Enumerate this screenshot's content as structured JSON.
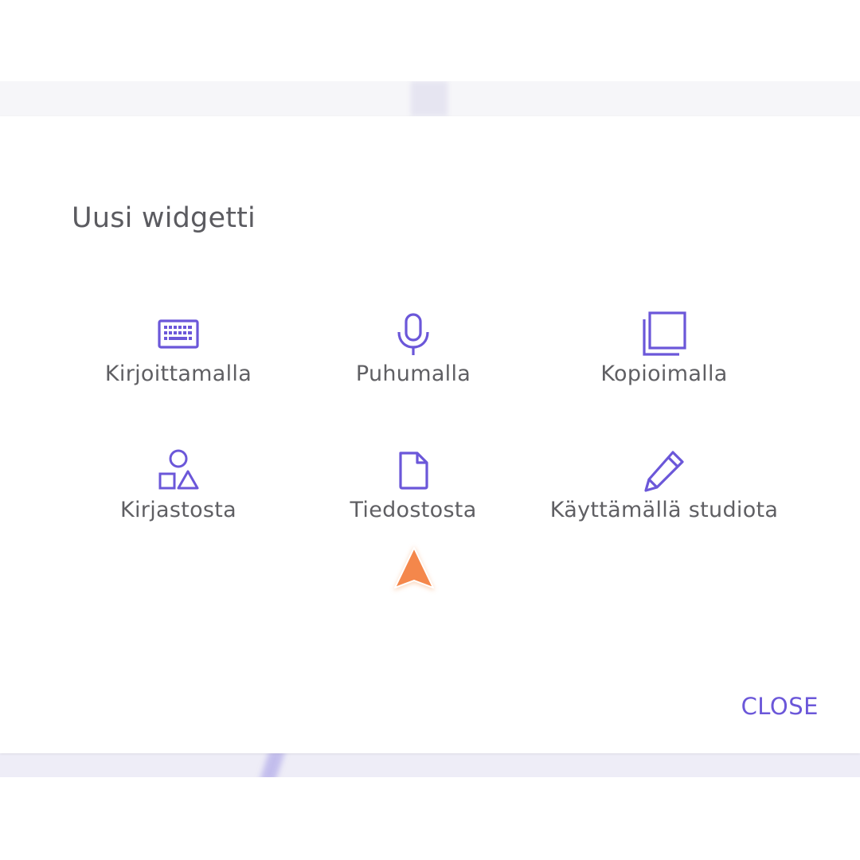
{
  "modal": {
    "title": "Uusi widgetti",
    "close_label": "CLOSE",
    "accent_color": "#6b57d9",
    "options": [
      {
        "label": "Kirjoittamalla",
        "icon": "keyboard-icon"
      },
      {
        "label": "Puhumalla",
        "icon": "microphone-icon"
      },
      {
        "label": "Kopioimalla",
        "icon": "copy-icon"
      },
      {
        "label": "Kirjastosta",
        "icon": "shapes-icon"
      },
      {
        "label": "Tiedostosta",
        "icon": "file-icon"
      },
      {
        "label": "Käyttämällä studiota",
        "icon": "pencil-icon"
      }
    ]
  },
  "cursor": {
    "icon": "pointer-arrow-icon",
    "color": "#f4874b"
  }
}
